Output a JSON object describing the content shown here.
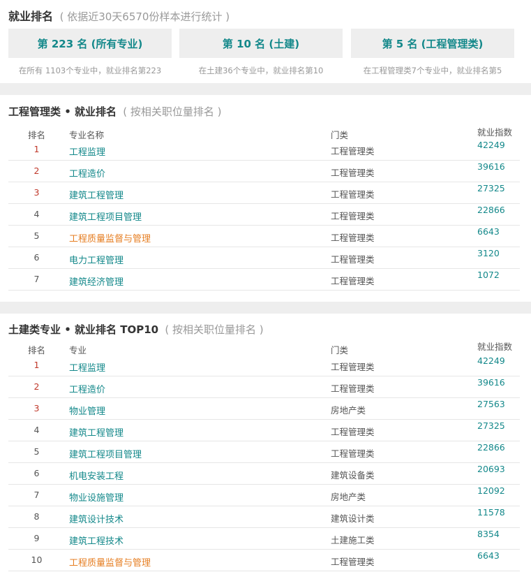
{
  "summary": {
    "title": "就业排名",
    "subtitle": "( 依据近30天6570份样本进行统计 )",
    "cards": [
      {
        "label": "第 223 名 (所有专业)",
        "note": "在所有 1103个专业中，就业排名第223"
      },
      {
        "label": "第 10 名 (土建)",
        "note": "在土建36个专业中，就业排名第10"
      },
      {
        "label": "第 5 名 (工程管理类)",
        "note": "在工程管理类7个专业中，就业排名第5"
      }
    ]
  },
  "section1": {
    "title": "工程管理类 • 就业排名",
    "subtitle": "( 按相关职位量排名 )",
    "headers": {
      "rank": "排名",
      "name": "专业名称",
      "category": "门类",
      "index": "就业指数"
    },
    "rows": [
      {
        "rank": "1",
        "name": "工程监理",
        "category": "工程管理类",
        "index": "42249"
      },
      {
        "rank": "2",
        "name": "工程造价",
        "category": "工程管理类",
        "index": "39616"
      },
      {
        "rank": "3",
        "name": "建筑工程管理",
        "category": "工程管理类",
        "index": "27325"
      },
      {
        "rank": "4",
        "name": "建筑工程项目管理",
        "category": "工程管理类",
        "index": "22866"
      },
      {
        "rank": "5",
        "name": "工程质量监督与管理",
        "category": "工程管理类",
        "index": "6643"
      },
      {
        "rank": "6",
        "name": "电力工程管理",
        "category": "工程管理类",
        "index": "3120"
      },
      {
        "rank": "7",
        "name": "建筑经济管理",
        "category": "工程管理类",
        "index": "1072"
      }
    ]
  },
  "section2": {
    "title": "土建类专业 • 就业排名 TOP10",
    "subtitle": "( 按相关职位量排名 )",
    "headers": {
      "rank": "排名",
      "name": "专业",
      "category": "门类",
      "index": "就业指数"
    },
    "rows": [
      {
        "rank": "1",
        "name": "工程监理",
        "category": "工程管理类",
        "index": "42249"
      },
      {
        "rank": "2",
        "name": "工程造价",
        "category": "工程管理类",
        "index": "39616"
      },
      {
        "rank": "3",
        "name": "物业管理",
        "category": "房地产类",
        "index": "27563"
      },
      {
        "rank": "4",
        "name": "建筑工程管理",
        "category": "工程管理类",
        "index": "27325"
      },
      {
        "rank": "5",
        "name": "建筑工程项目管理",
        "category": "工程管理类",
        "index": "22866"
      },
      {
        "rank": "6",
        "name": "机电安装工程",
        "category": "建筑设备类",
        "index": "20693"
      },
      {
        "rank": "7",
        "name": "物业设施管理",
        "category": "房地产类",
        "index": "12092"
      },
      {
        "rank": "8",
        "name": "建筑设计技术",
        "category": "建筑设计类",
        "index": "11578"
      },
      {
        "rank": "9",
        "name": "建筑工程技术",
        "category": "土建施工类",
        "index": "8354"
      },
      {
        "rank": "10",
        "name": "工程质量监督与管理",
        "category": "工程管理类",
        "index": "6643"
      }
    ]
  },
  "colors": {
    "accent": "#13888a",
    "top_rank": "#c0392b",
    "highlight": "#e67e22",
    "card_bg": "#eeeeee"
  }
}
